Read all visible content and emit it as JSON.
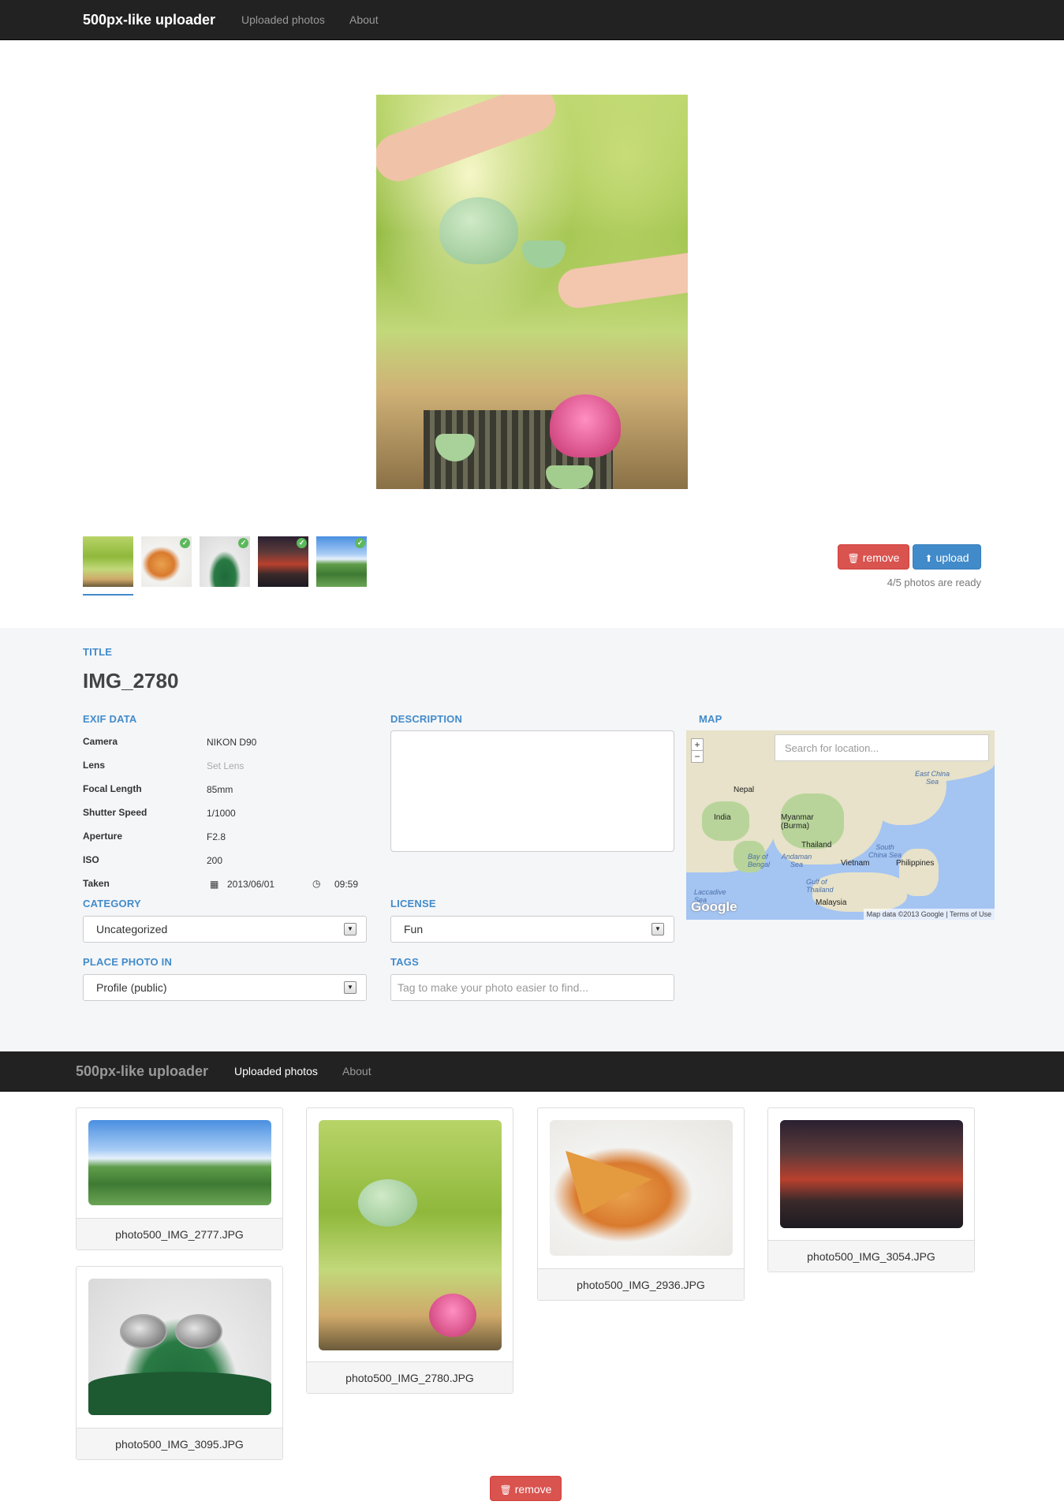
{
  "navbar": {
    "brand": "500px-like uploader",
    "links": [
      "Uploaded photos",
      "About"
    ]
  },
  "uploader": {
    "thumbnails": [
      {
        "name": "IMG_2780",
        "ready": false,
        "selected": true
      },
      {
        "name": "IMG_2936",
        "ready": true
      },
      {
        "name": "IMG_3095",
        "ready": true
      },
      {
        "name": "IMG_3054",
        "ready": true
      },
      {
        "name": "IMG_2777",
        "ready": true
      }
    ],
    "remove_label": "remove",
    "upload_label": "upload",
    "status": "4/5 photos are ready"
  },
  "form": {
    "title_label": "TITLE",
    "title_value": "IMG_2780",
    "exif_label": "EXIF DATA",
    "exif": [
      {
        "key": "Camera",
        "value": "NIKON D90"
      },
      {
        "key": "Lens",
        "value": "Set Lens",
        "placeholder": true
      },
      {
        "key": "Focal Length",
        "value": "85mm"
      },
      {
        "key": "Shutter Speed",
        "value": "1/1000"
      },
      {
        "key": "Aperture",
        "value": "F2.8"
      },
      {
        "key": "ISO",
        "value": "200"
      },
      {
        "key": "Taken",
        "date": "2013/06/01",
        "time": "09:59"
      }
    ],
    "description_label": "DESCRIPTION",
    "description_value": "",
    "map_label": "MAP",
    "map_search_placeholder": "Search for location...",
    "map_places": [
      "Nepal",
      "India",
      "Myanmar (Burma)",
      "Thailand",
      "Vietnam",
      "Philippines",
      "Malaysia"
    ],
    "map_seas": [
      "East China Sea",
      "South China Sea",
      "Bay of Bengal",
      "Andaman Sea",
      "Gulf of Thailand",
      "Laccadive Sea"
    ],
    "map_logo": "Google",
    "map_attribution": "Map data ©2013 Google",
    "map_terms": "Terms of Use",
    "category_label": "CATEGORY",
    "category_value": "Uncategorized",
    "license_label": "LICENSE",
    "license_value": "Fun",
    "place_label": "PLACE PHOTO IN",
    "place_value": "Profile (public)",
    "tags_label": "TAGS",
    "tags_placeholder": "Tag to make your photo easier to find..."
  },
  "gallery": {
    "active_tab": "Uploaded photos",
    "photos": [
      {
        "filename": "photo500_IMG_2777.JPG"
      },
      {
        "filename": "photo500_IMG_2780.JPG"
      },
      {
        "filename": "photo500_IMG_2936.JPG"
      },
      {
        "filename": "photo500_IMG_3054.JPG"
      },
      {
        "filename": "photo500_IMG_3095.JPG"
      }
    ],
    "remove_label": "remove"
  },
  "colors": {
    "navbar_bg": "#222222",
    "accent": "#428bca",
    "danger": "#d9534f",
    "success": "#5cb85c",
    "panel_bg": "#f5f6f8"
  }
}
